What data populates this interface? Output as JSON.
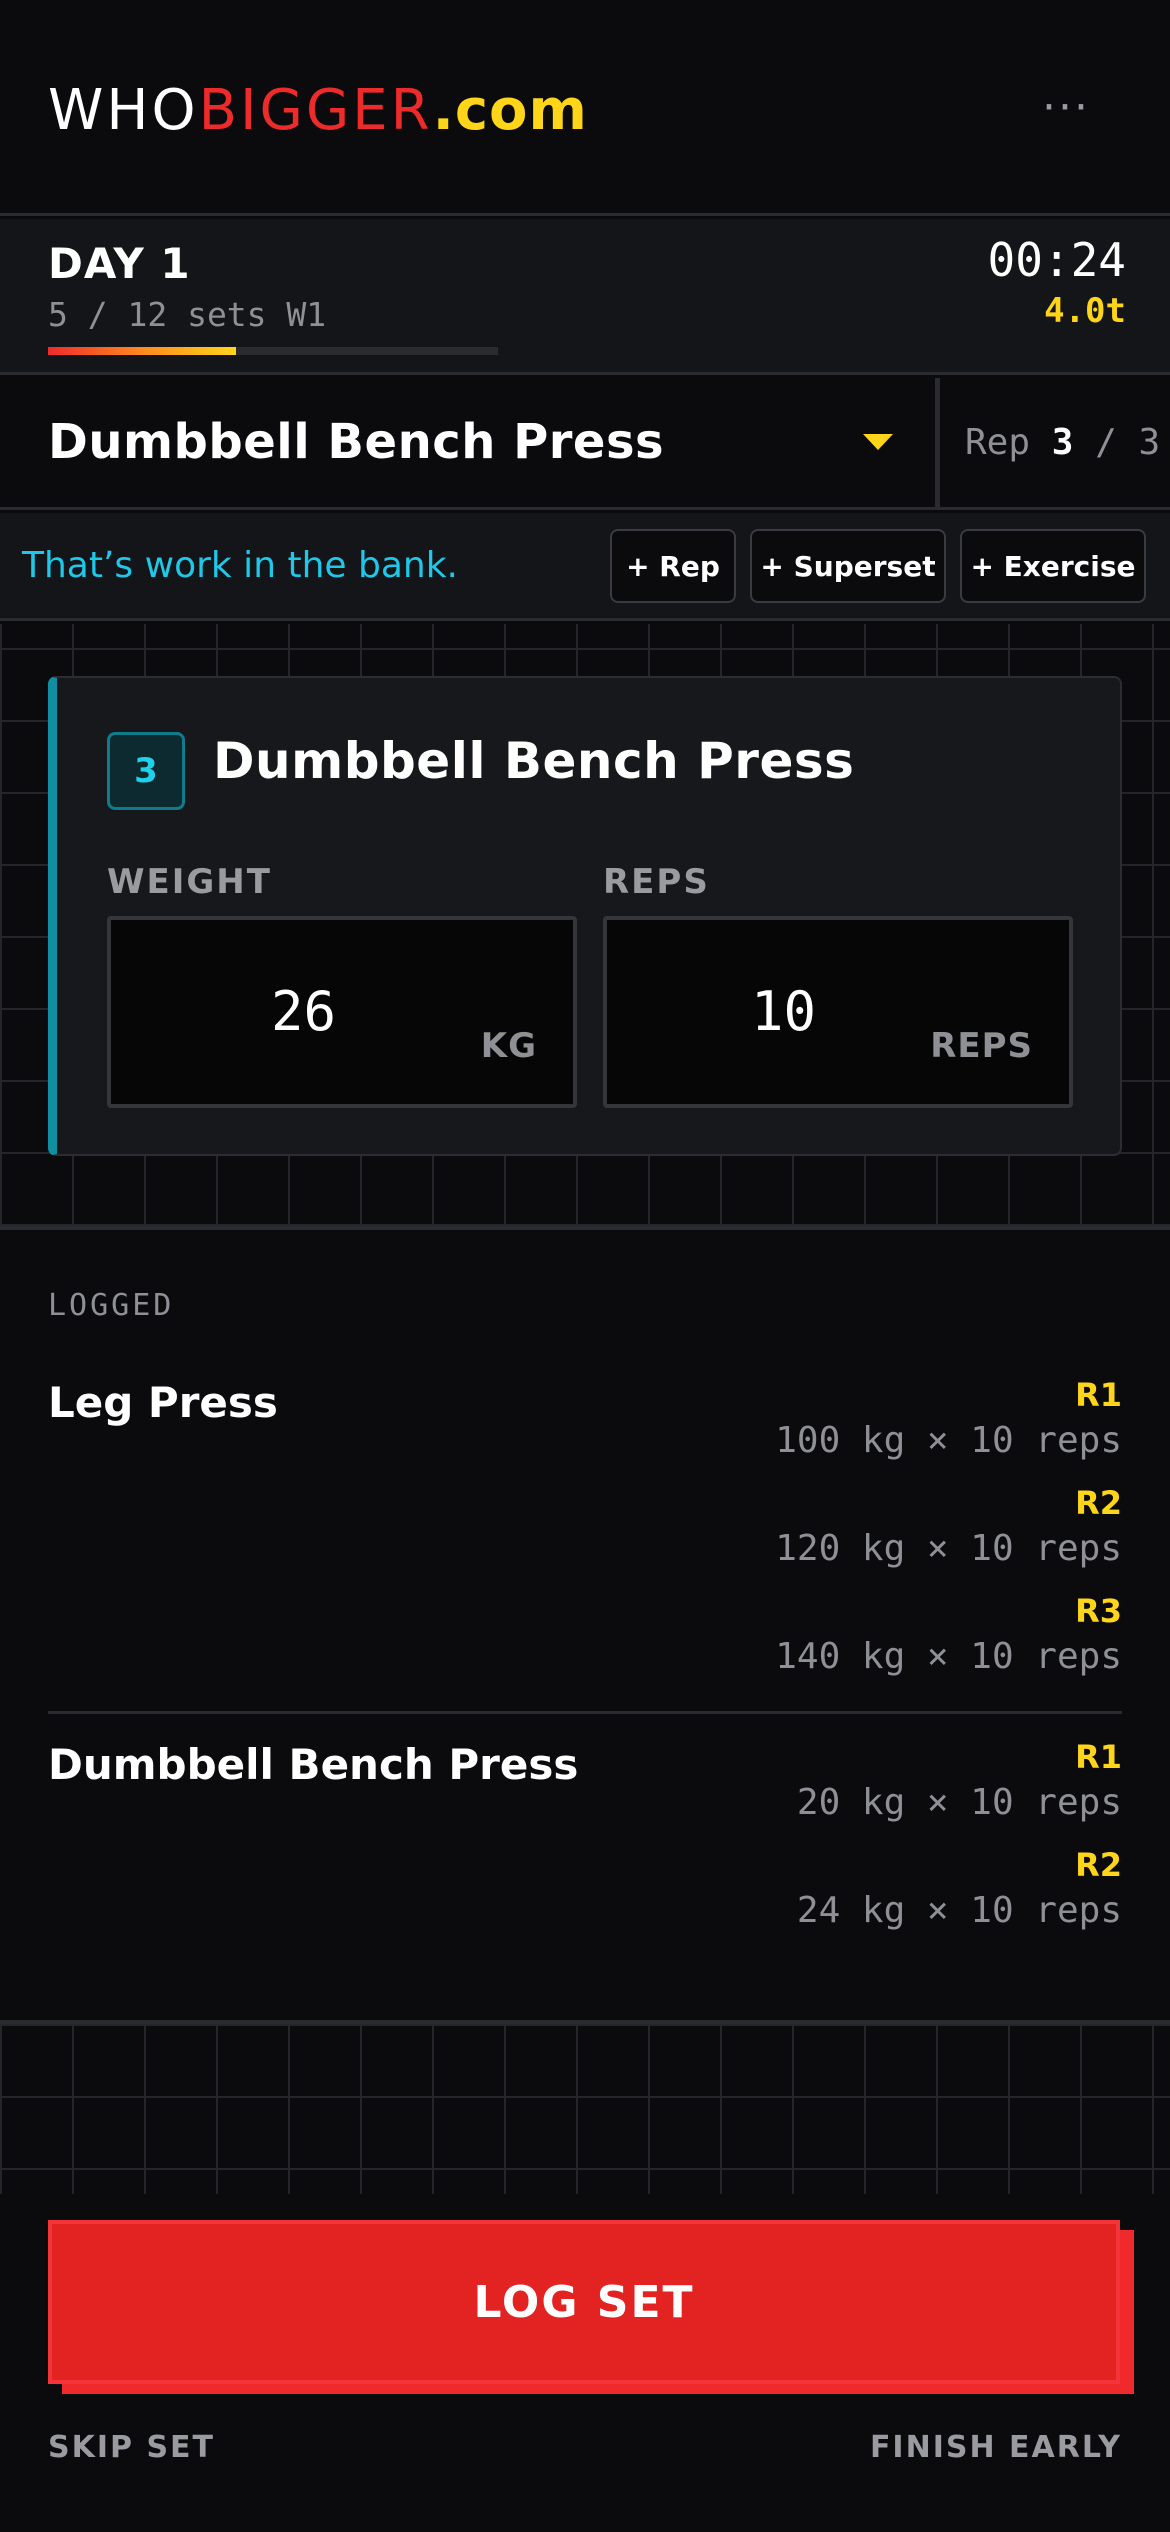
{
  "header": {
    "logo_part1": "WHO",
    "logo_part2": "BIGGER",
    "logo_part3": ".com",
    "menu_icon": "more-dots-icon",
    "menu_glyph": "···"
  },
  "day": {
    "title": "DAY 1",
    "progress_text": "5 / 12 sets W1",
    "progress_fraction": 0.4167,
    "timer": "00:24",
    "tonnage": "4.0t"
  },
  "exercise": {
    "name": "Dumbbell Bench Press",
    "dropdown_icon": "caret-down-icon",
    "rep_label": "Rep",
    "rep_current": "3",
    "rep_separator": "/",
    "rep_total": "3"
  },
  "actions": {
    "feedback": "That’s work in the bank.",
    "add_rep": "+ Rep",
    "add_superset": "+ Superset",
    "add_exercise": "+ Exercise"
  },
  "set_card": {
    "number": "3",
    "title": "Dumbbell Bench Press",
    "weight_label": "WEIGHT",
    "weight_value": "26",
    "weight_unit": "KG",
    "reps_label": "REPS",
    "reps_value": "10",
    "reps_unit": "REPS"
  },
  "logged": {
    "title": "LOGGED",
    "groups": [
      {
        "name": "Leg Press",
        "sets": [
          {
            "round": "R1",
            "detail": "100 kg × 10 reps"
          },
          {
            "round": "R2",
            "detail": "120 kg × 10 reps"
          },
          {
            "round": "R3",
            "detail": "140 kg × 10 reps"
          }
        ]
      },
      {
        "name": "Dumbbell Bench Press",
        "sets": [
          {
            "round": "R1",
            "detail": "20 kg × 10 reps"
          },
          {
            "round": "R2",
            "detail": "24 kg × 10 reps"
          }
        ]
      }
    ]
  },
  "footer": {
    "log_set": "LOG SET",
    "skip_set": "SKIP SET",
    "finish_early": "FINISH EARLY"
  },
  "colors": {
    "background": "#0b0b0d",
    "brand_red": "#ee2b2b",
    "brand_yellow": "#ffd51a",
    "accent_cyan": "#1fc7e8",
    "teal": "#0f8fa0"
  }
}
